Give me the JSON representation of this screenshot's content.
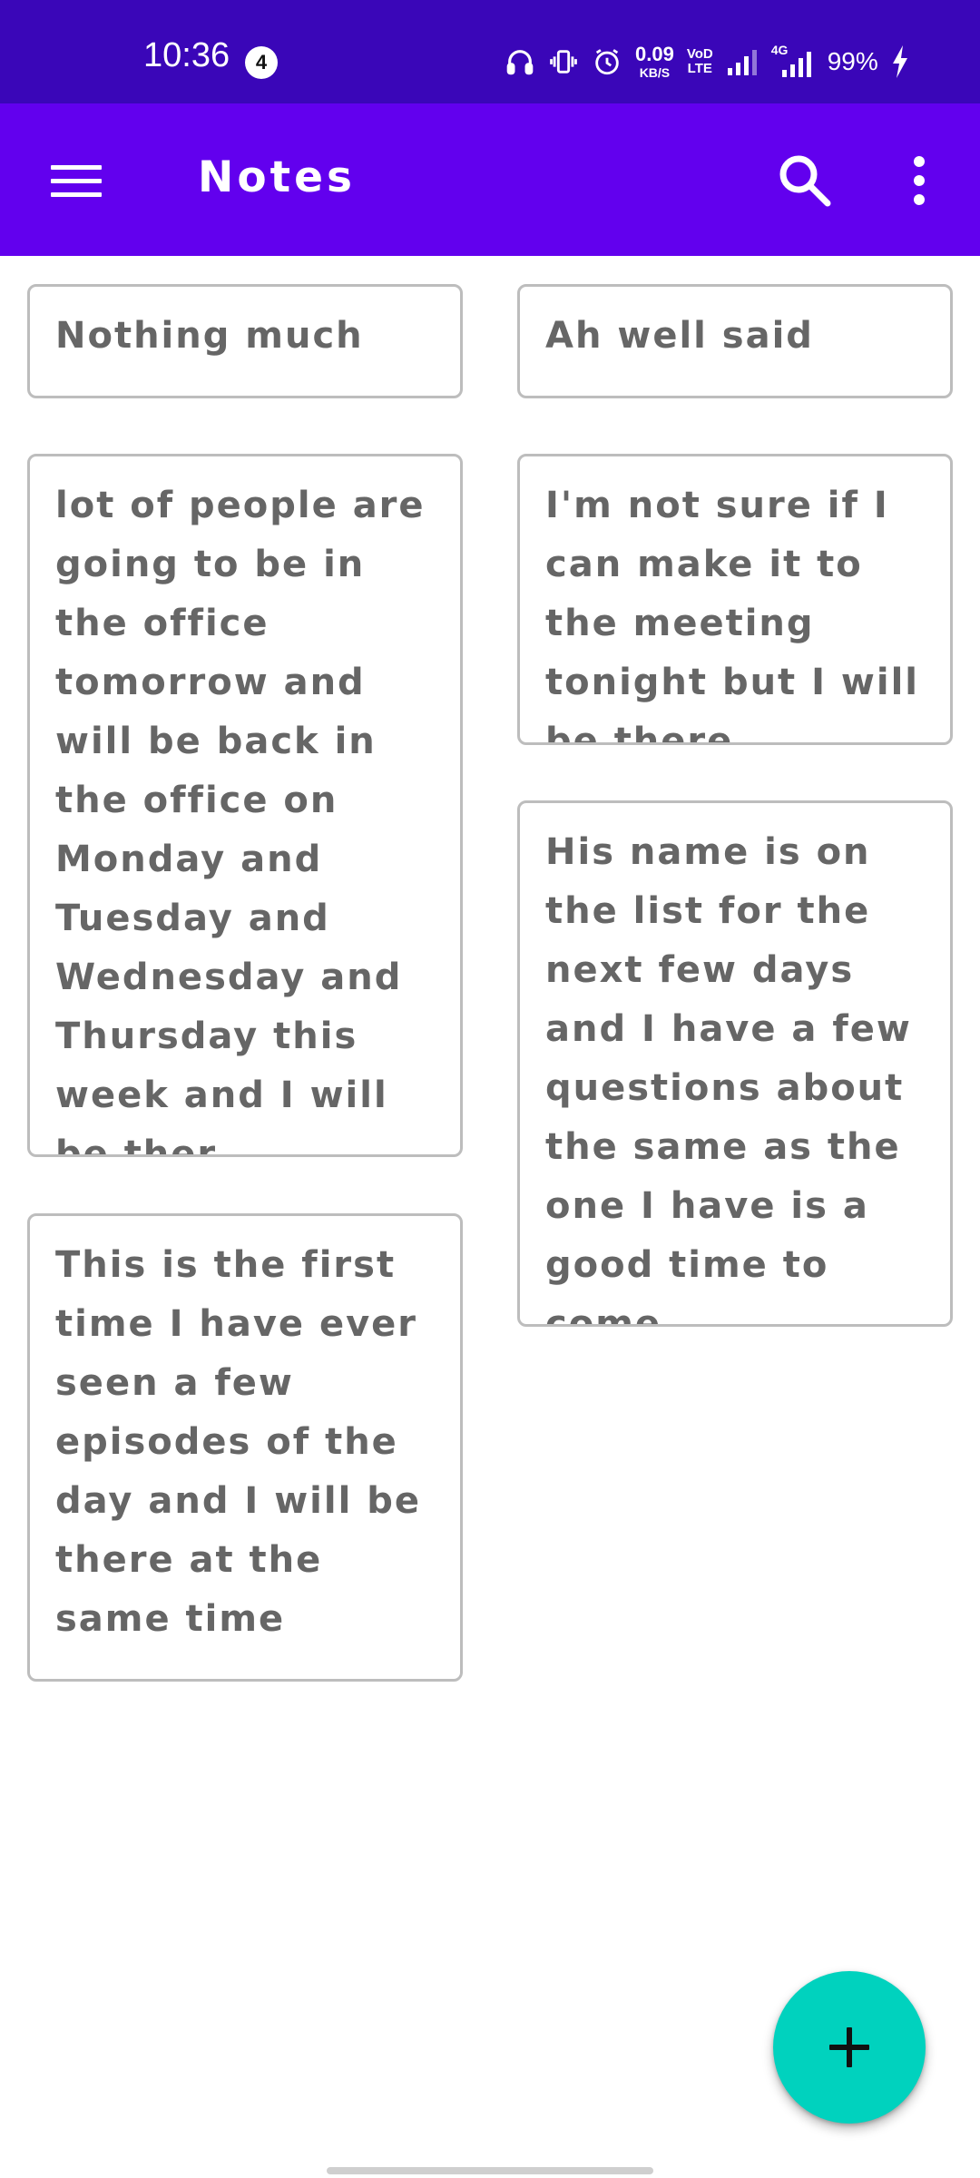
{
  "status_bar": {
    "time": "10:36",
    "notification_count": "4",
    "net_speed_value": "0.09",
    "net_speed_unit": "KB/S",
    "volte_line1": "VoD",
    "volte_line2": "LTE",
    "network_label": "4G",
    "battery": "99%"
  },
  "app_bar": {
    "title": "Notes",
    "icons": {
      "menu": "hamburger-menu-icon",
      "search": "search-icon",
      "more": "more-vert-icon"
    },
    "background": "#6200ee"
  },
  "notes": [
    {
      "text": "Nothing much"
    },
    {
      "text": "Ah well said"
    },
    {
      "text": "lot of people are going to be in the office tomorrow and will be back in the office on Monday and Tuesday and Wednesday and Thursday this week and I will be ther"
    },
    {
      "text": "I'm not sure if I can make it to the meeting tonight but I will be there"
    },
    {
      "text": "His name is on the list for the next few days and I have a few questions about the same as the one I have is a good time to come"
    },
    {
      "text": "This is the first time I have ever seen a few episodes of the day and I will be there at the same time"
    }
  ],
  "fab": {
    "icon": "add-icon",
    "color": "#00d2be"
  },
  "colors": {
    "status_bar": "#3a06b8",
    "app_bar": "#6200ee",
    "note_text": "#666666",
    "note_border": "#bdbdbd"
  }
}
